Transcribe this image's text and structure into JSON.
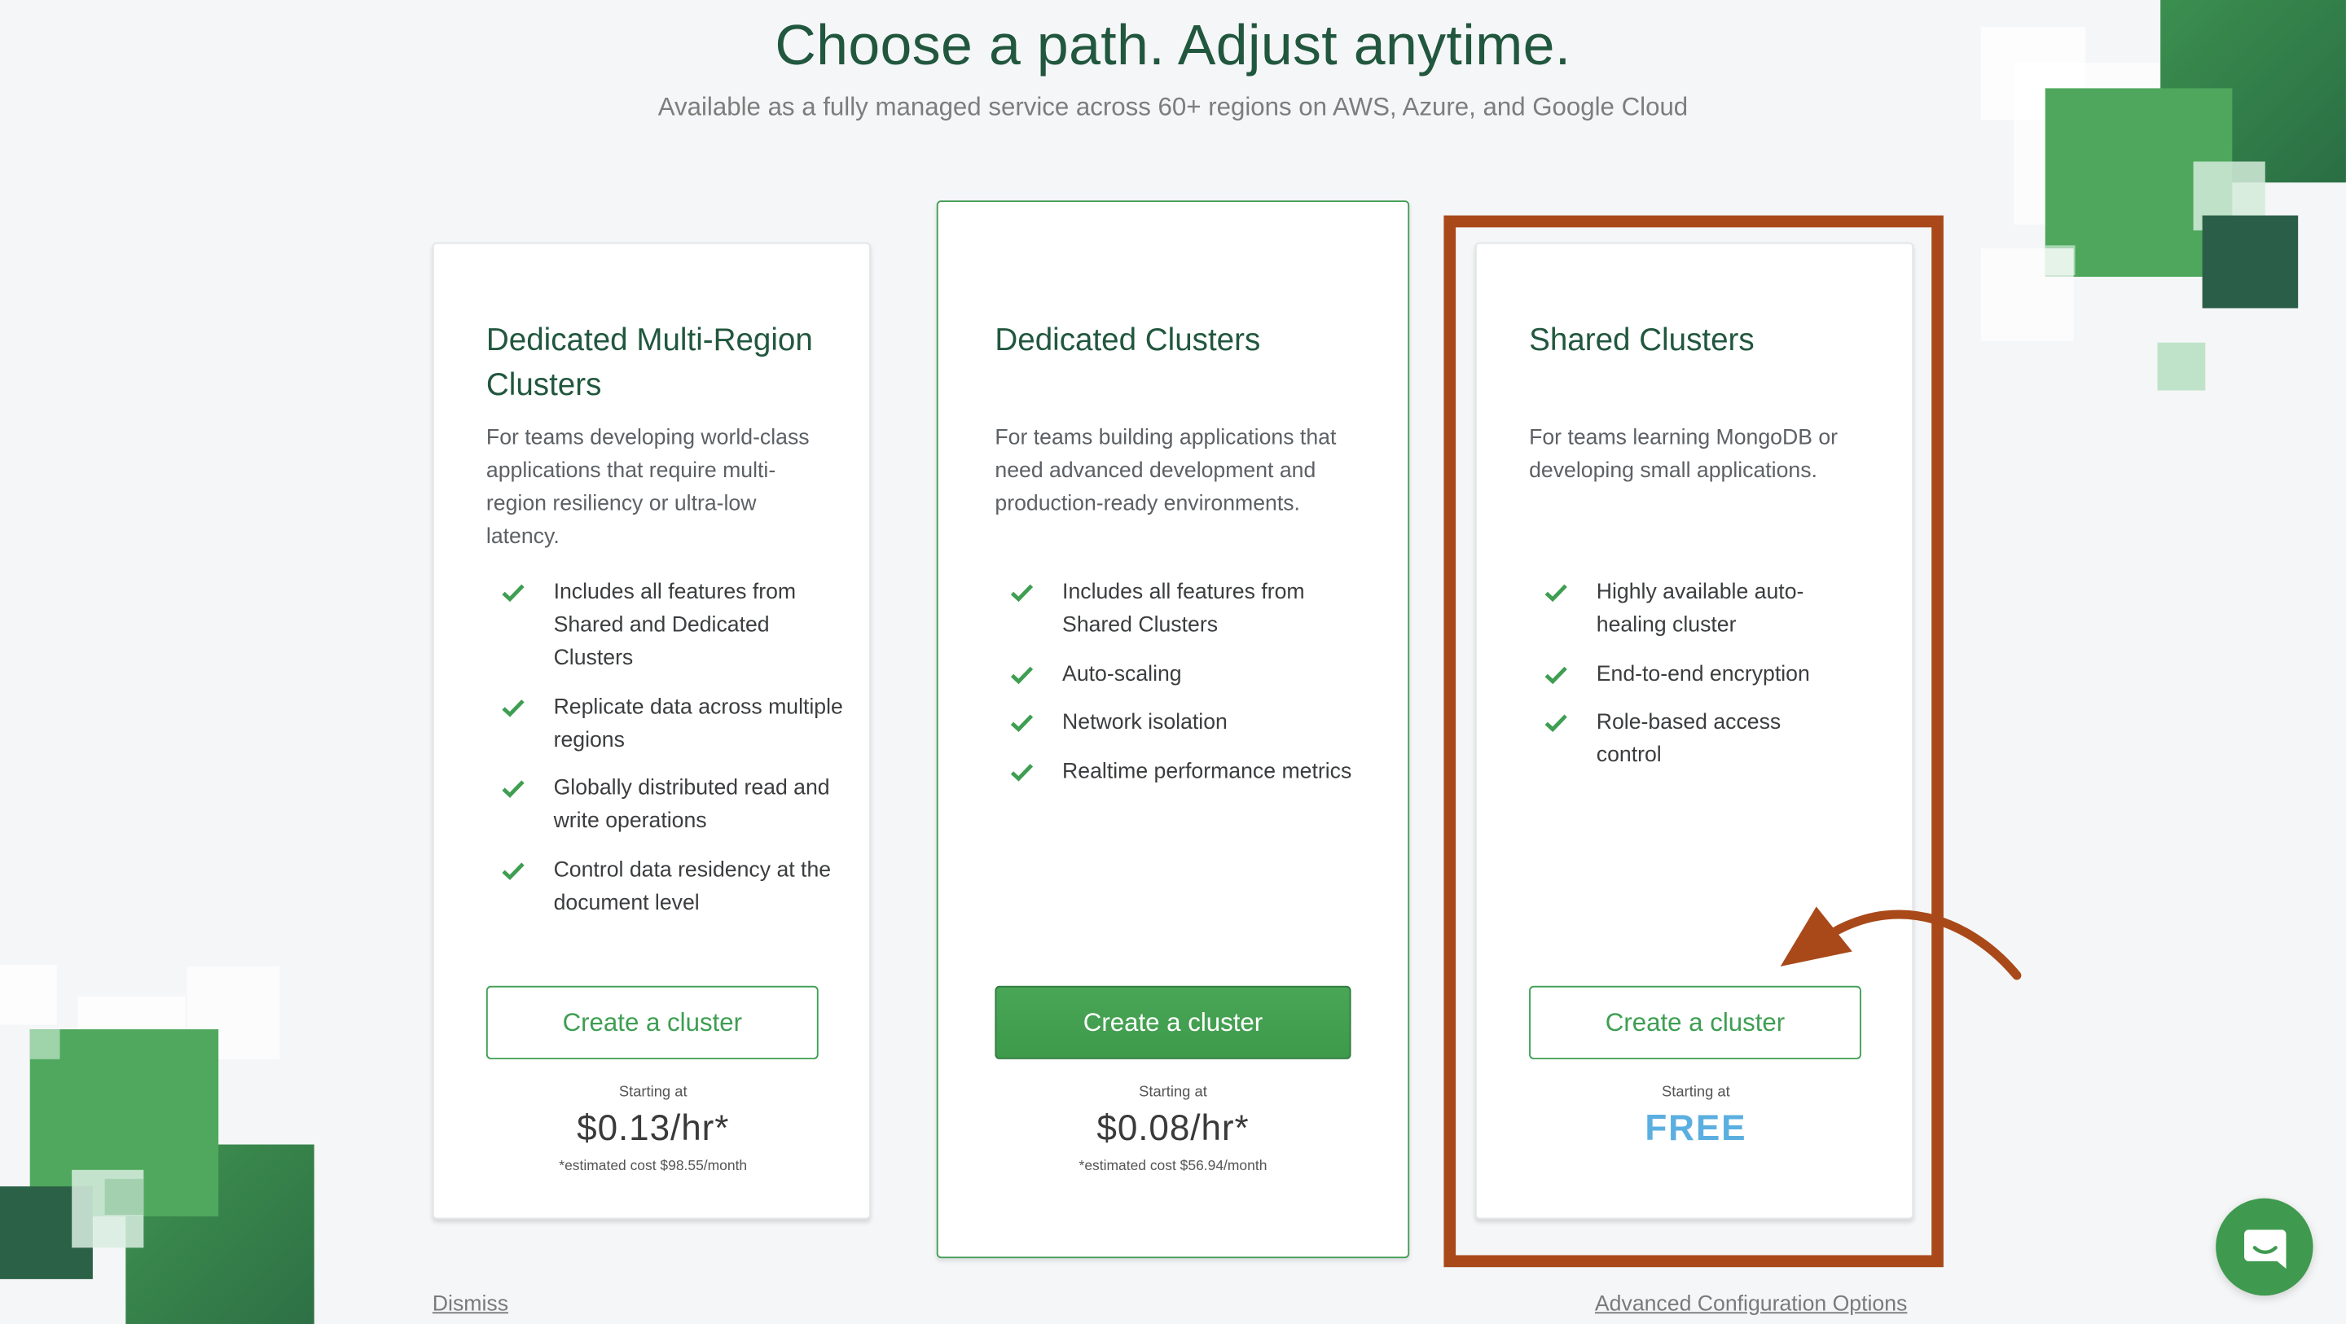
{
  "header": {
    "title": "Choose a path. Adjust anytime.",
    "subtitle": "Available as a fully managed service across 60+ regions on AWS, Azure, and Google Cloud"
  },
  "plans": [
    {
      "title": "Dedicated Multi-Region Clusters",
      "description": "For teams developing world-class applications that require multi-region resiliency or ultra-low latency.",
      "features": [
        "Includes all features from Shared and Dedicated Clusters",
        "Replicate data across multiple regions",
        "Globally distributed read and write operations",
        "Control data residency at the document level"
      ],
      "button_label": "Create a cluster",
      "starting_label": "Starting at",
      "price": "$0.13/hr*",
      "estimate": "*estimated cost $98.55/month"
    },
    {
      "title": "Dedicated Clusters",
      "description": "For teams building applications that need advanced development and production-ready environments.",
      "features": [
        "Includes all features from Shared Clusters",
        "Auto-scaling",
        "Network isolation",
        "Realtime performance metrics"
      ],
      "button_label": "Create a cluster",
      "starting_label": "Starting at",
      "price": "$0.08/hr*",
      "estimate": "*estimated cost $56.94/month"
    },
    {
      "title": "Shared Clusters",
      "description": "For teams learning MongoDB or developing small applications.",
      "features": [
        "Highly available auto-healing cluster",
        "End-to-end encryption",
        "Role-based access control"
      ],
      "button_label": "Create a cluster",
      "starting_label": "Starting at",
      "price": "FREE"
    }
  ],
  "footer": {
    "dismiss": "Dismiss",
    "advanced": "Advanced Configuration Options"
  },
  "colors": {
    "brand_green": "#3e9e52",
    "title_green": "#21573e",
    "free_blue": "#5bafe0",
    "annotation": "#a9491a"
  },
  "icons": [
    "check-icon",
    "arrow-annotation-icon",
    "chat-icon"
  ]
}
